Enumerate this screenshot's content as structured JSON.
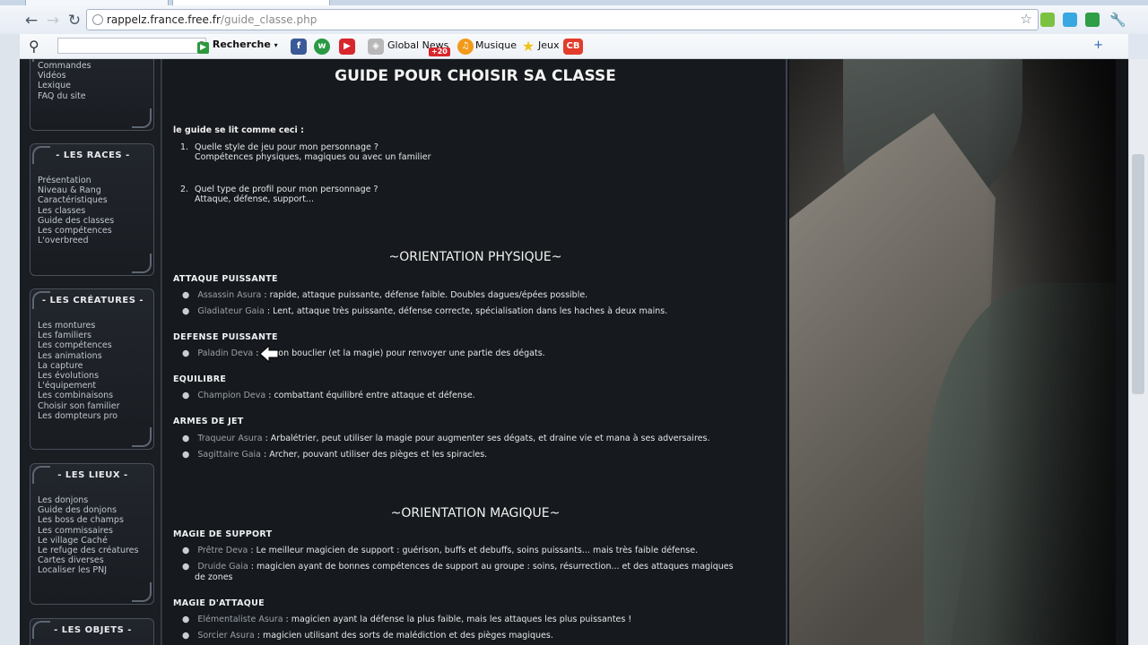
{
  "browser": {
    "url_host": "rappelz.france.free.fr",
    "url_path": "/guide_classe.php"
  },
  "toolbar": {
    "search_button": "Recherche",
    "links": [
      "Global News",
      "Musique",
      "Jeux"
    ],
    "badge": "+20",
    "icons": [
      "facebook-icon",
      "wordpress-icon",
      "youtube-icon",
      "global-news-icon",
      "music-icon",
      "star-icon",
      "cb-icon"
    ]
  },
  "sidebar": {
    "box0": {
      "items": [
        "Commandes",
        "Vidéos",
        "Lexique",
        "FAQ du site"
      ]
    },
    "box1": {
      "title": "- LES RACES -",
      "items": [
        "Présentation",
        "Niveau & Rang",
        "Caractéristiques",
        "Les classes",
        "Guide des classes",
        "Les compétences",
        "L'overbreed"
      ]
    },
    "box2": {
      "title": "- LES CRÉATURES -",
      "items": [
        "Les montures",
        "Les familiers",
        "Les compétences",
        "Les animations",
        "La capture",
        "Les évolutions",
        "L'équipement",
        "Les combinaisons",
        "Choisir son familier",
        "Les dompteurs pro"
      ]
    },
    "box3": {
      "title": "- LES LIEUX -",
      "items": [
        "Les donjons",
        "Guide des donjons",
        "Les boss de champs",
        "Les commissaires",
        "Le village Caché",
        "Le refuge des créatures",
        "Cartes diverses",
        "Localiser les PNJ"
      ]
    },
    "box4": {
      "title": "- LES OBJETS -"
    }
  },
  "main": {
    "title": "GUIDE POUR CHOISIR SA CLASSE",
    "intro": "le guide se lit comme ceci :",
    "q1_num": "1.",
    "q1_line1": "Quelle style de jeu pour mon personnage ?",
    "q1_line2": "Compétences physiques, magiques ou avec un familier",
    "q2_num": "2.",
    "q2_line1": "Quel type de profil pour mon personnage ?",
    "q2_line2": "Attaque, défense, support...",
    "section1": "~ORIENTATION PHYSIQUE~",
    "section2": "~ORIENTATION MAGIQUE~",
    "categories": [
      {
        "name": "ATTAQUE PUISSANTE",
        "entries": [
          {
            "cls": "Assassin Asura",
            "desc": " : rapide, attaque puissante, défense faible. Doubles dagues/épées possible."
          },
          {
            "cls": "Gladiateur Gaia",
            "desc": " : Lent, attaque très puissante, défense correcte, spécialisation dans les haches à deux mains."
          }
        ]
      },
      {
        "name": "DEFENSE PUISSANTE",
        "entries": [
          {
            "cls": "Paladin Deva",
            "desc": " :  se son bouclier (et la magie) pour renvoyer une partie des dégats."
          }
        ]
      },
      {
        "name": "EQUILIBRE",
        "entries": [
          {
            "cls": "Champion Deva",
            "desc": " : combattant équilibré entre attaque et défense."
          }
        ]
      },
      {
        "name": "ARMES DE JET",
        "entries": [
          {
            "cls": "Traqueur Asura",
            "desc": " : Arbalétrier, peut utiliser la magie pour augmenter ses dégats, et draine vie et mana à ses adversaires."
          },
          {
            "cls": "Sagittaire Gaia",
            "desc": " : Archer, pouvant utiliser des pièges et les spiracles."
          }
        ]
      },
      {
        "name": "MAGIE DE SUPPORT",
        "entries": [
          {
            "cls": "Prêtre Deva",
            "desc": " : Le meilleur magicien de support : guérison, buffs et debuffs, soins puissants... mais très faible défense."
          },
          {
            "cls": "Druide Gaia",
            "desc": " : magicien ayant de bonnes compétences de support au groupe : soins, résurrection... et des attaques magiques",
            "line2": "de zones"
          }
        ]
      },
      {
        "name": "MAGIE D'ATTAQUE",
        "entries": [
          {
            "cls": "Elémentaliste Asura",
            "desc": " : magicien ayant la défense la plus faible, mais les attaques les plus puissantes !"
          },
          {
            "cls": "Sorcier Asura",
            "desc": " : magicien utilisant des sorts de malédiction et des pièges magiques."
          }
        ]
      }
    ]
  }
}
